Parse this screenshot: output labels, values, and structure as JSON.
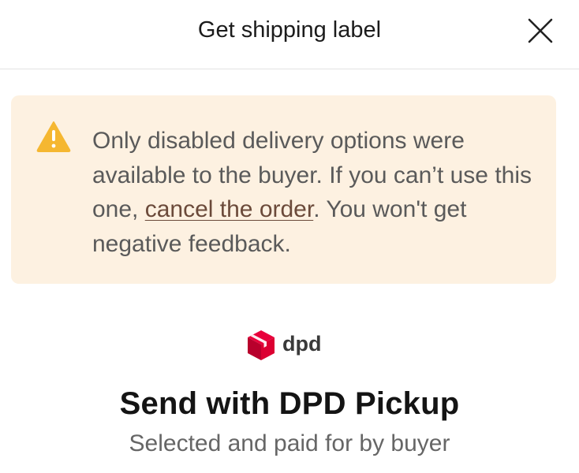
{
  "header": {
    "title": "Get shipping label",
    "close_icon": "close-icon"
  },
  "notice": {
    "icon": "warning-icon",
    "icon_color": "#f5b731",
    "background": "#fdf1e1",
    "text_before_link": "Only disabled delivery options were available to the buyer. If you can’t use this one, ",
    "link_text": "cancel the order",
    "text_after_link": ". You won't get negative feedback."
  },
  "carrier": {
    "logo_icon": "dpd-cube-icon",
    "logo_color": "#dc0032",
    "name": "dpd"
  },
  "shipping": {
    "title": "Send with DPD Pickup",
    "subtitle": "Selected and paid for by buyer"
  }
}
